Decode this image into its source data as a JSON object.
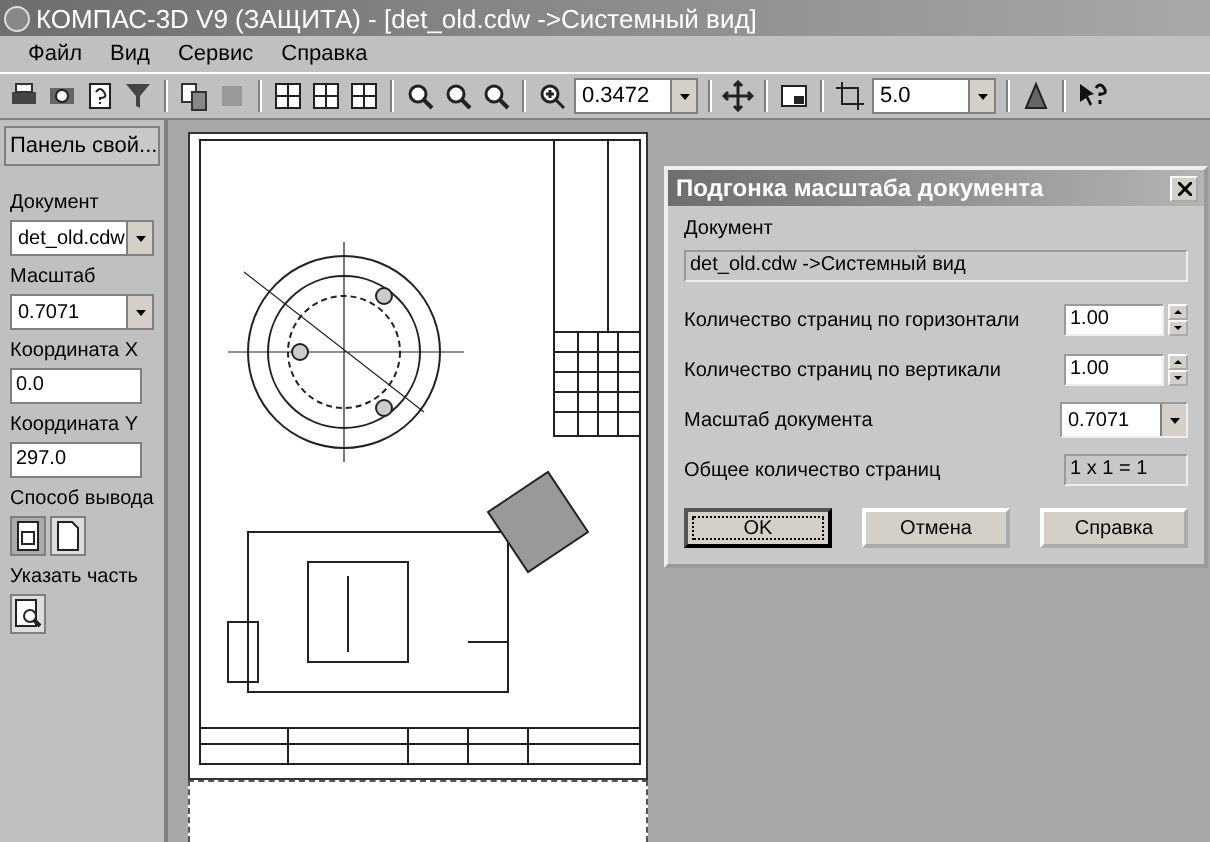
{
  "window": {
    "title": "КОМПАС-3D V9 (ЗАЩИТА) - [det_old.cdw ->Системный вид]"
  },
  "menu": [
    "Файл",
    "Вид",
    "Сервис",
    "Справка"
  ],
  "toolbar": {
    "zoom": "0.3472",
    "step": "5.0"
  },
  "panel": {
    "tab": "Панель свой...",
    "fields": [
      {
        "label": "Документ",
        "kind": "combo",
        "value": "det_old.cdw"
      },
      {
        "label": "Масштаб",
        "kind": "combo",
        "value": "0.7071"
      },
      {
        "label": "Координата X",
        "kind": "text",
        "value": "0.0"
      },
      {
        "label": "Координата Y",
        "kind": "text",
        "value": "297.0"
      }
    ],
    "output_label": "Способ вывода",
    "part_label": "Указать часть"
  },
  "dialog": {
    "title": "Подгонка масштаба документа",
    "doc_label": "Документ",
    "doc_value": "det_old.cdw ->Системный вид",
    "rows": [
      {
        "label": "Количество страниц по горизонтали",
        "kind": "spin",
        "value": "1.00"
      },
      {
        "label": "Количество страниц по вертикали",
        "kind": "spin",
        "value": "1.00"
      },
      {
        "label": "Масштаб документа",
        "kind": "combo",
        "value": "0.7071"
      },
      {
        "label": "Общее количество страниц",
        "kind": "readonly",
        "value": "1 x 1 = 1"
      }
    ],
    "buttons": [
      {
        "label": "OK",
        "selected": true
      },
      {
        "label": "Отмена",
        "selected": false
      },
      {
        "label": "Справка",
        "selected": false
      }
    ]
  }
}
